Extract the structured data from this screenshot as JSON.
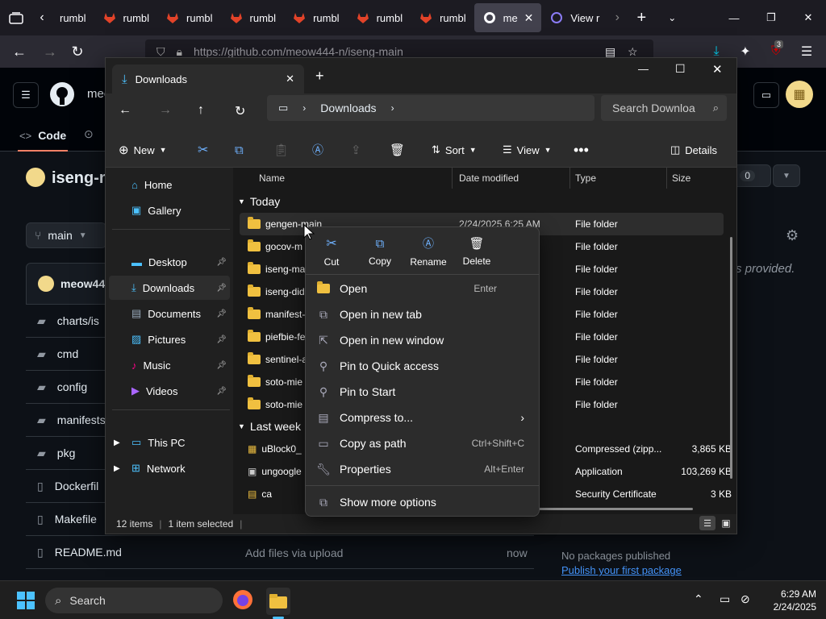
{
  "browser": {
    "tabs": [
      {
        "label": "rumbl",
        "fav": "github-icon"
      },
      {
        "label": "rumbl",
        "fav": "gitlab-icon"
      },
      {
        "label": "rumbl",
        "fav": "gitlab-icon"
      },
      {
        "label": "rumbl",
        "fav": "gitlab-icon"
      },
      {
        "label": "rumbl",
        "fav": "gitlab-icon"
      },
      {
        "label": "rumbl",
        "fav": "gitlab-icon"
      },
      {
        "label": "rumbl",
        "fav": "gitlab-icon"
      },
      {
        "label": "me",
        "fav": "github-icon"
      },
      {
        "label": "View r",
        "fav": "viewer-icon"
      }
    ],
    "url": "https://github.com/meow444-n/iseng-main",
    "download_badge": "3"
  },
  "github": {
    "owner_short": "meo",
    "repo_title": "iseng-m",
    "tab_code": "Code",
    "branch": "main",
    "author": "meow44",
    "star_suffix": "r",
    "star_count": "0",
    "about_text": "s provided.",
    "files": [
      "charts/is",
      "cmd",
      "config",
      "manifests",
      "pkg",
      "Dockerfil",
      "Makefile",
      "README.md"
    ],
    "upload_text": "Add files via upload",
    "upload_time": "now",
    "no_packages": "No packages published",
    "publish_link": "Publish your first package"
  },
  "explorer": {
    "tab_title": "Downloads",
    "breadcrumb": "Downloads",
    "search_placeholder": "Search Downloa",
    "cmd": {
      "new": "New",
      "sort": "Sort",
      "view": "View",
      "details": "Details"
    },
    "sidebar": {
      "home": "Home",
      "gallery": "Gallery",
      "desktop": "Desktop",
      "downloads": "Downloads",
      "documents": "Documents",
      "pictures": "Pictures",
      "music": "Music",
      "videos": "Videos",
      "thispc": "This PC",
      "network": "Network"
    },
    "columns": {
      "name": "Name",
      "date": "Date modified",
      "type": "Type",
      "size": "Size"
    },
    "group_today": "Today",
    "group_lastweek": "Last week",
    "today_rows": [
      {
        "name": "gengen-main",
        "date": "2/24/2025 6:25 AM",
        "type": "File folder"
      },
      {
        "name": "gocov-m",
        "type": "File folder"
      },
      {
        "name": "iseng-ma",
        "type": "File folder"
      },
      {
        "name": "iseng-did",
        "type": "File folder"
      },
      {
        "name": "manifest-",
        "type": "File folder"
      },
      {
        "name": "piefbie-fe",
        "type": "File folder"
      },
      {
        "name": "sentinel-a",
        "type": "File folder"
      },
      {
        "name": "soto-mie",
        "type": "File folder"
      },
      {
        "name": "soto-mie",
        "type": "File folder"
      }
    ],
    "lastweek_rows": [
      {
        "name": "uBlock0_",
        "type": "Compressed (zipp...",
        "size": "3,865 KB"
      },
      {
        "name": "ungoogle",
        "type": "Application",
        "size": "103,269 KB"
      },
      {
        "name": "ca",
        "type": "Security Certificate",
        "size": "3 KB"
      }
    ],
    "status_items": "12 items",
    "status_selected": "1 item selected"
  },
  "context_menu": {
    "quick": {
      "cut": "Cut",
      "copy": "Copy",
      "rename": "Rename",
      "delete": "Delete"
    },
    "items": [
      {
        "label": "Open",
        "shortcut": "Enter"
      },
      {
        "label": "Open in new tab",
        "shortcut": ""
      },
      {
        "label": "Open in new window",
        "shortcut": ""
      },
      {
        "label": "Pin to Quick access",
        "shortcut": ""
      },
      {
        "label": "Pin to Start",
        "shortcut": ""
      },
      {
        "label": "Compress to...",
        "shortcut": ""
      },
      {
        "label": "Copy as path",
        "shortcut": "Ctrl+Shift+C"
      },
      {
        "label": "Properties",
        "shortcut": "Alt+Enter"
      },
      {
        "label": "Show more options",
        "shortcut": ""
      }
    ]
  },
  "taskbar": {
    "search": "Search",
    "time": "6:29 AM",
    "date": "2/24/2025"
  }
}
